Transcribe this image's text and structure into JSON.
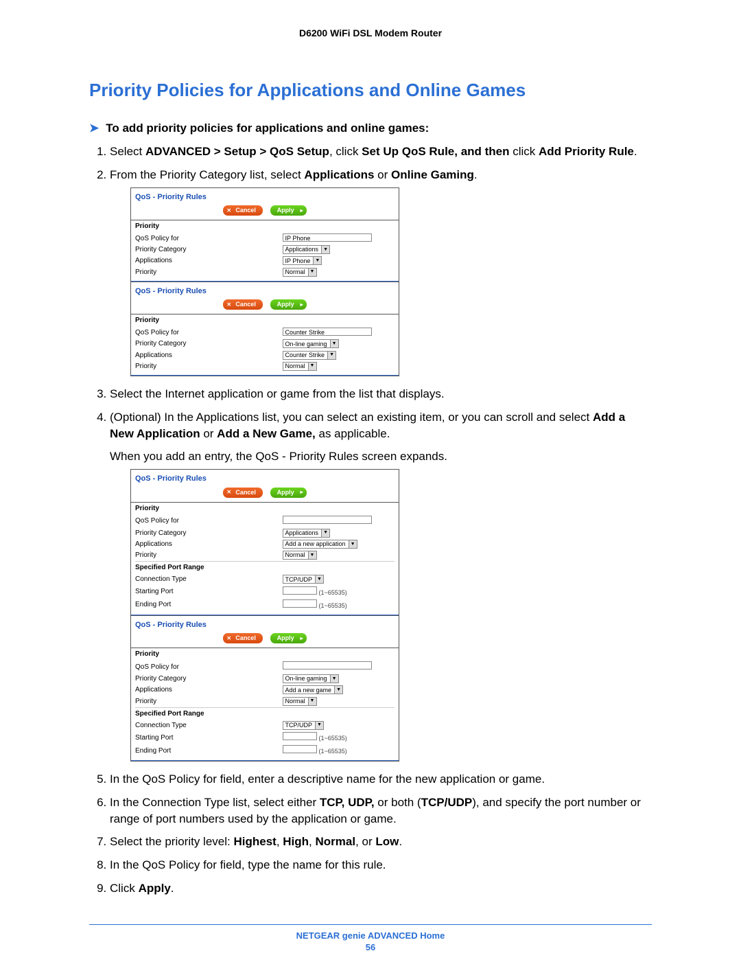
{
  "header": "D6200 WiFi DSL Modem Router",
  "title": "Priority Policies for Applications and Online Games",
  "lead": "To add priority policies for applications and online games:",
  "steps": {
    "s1a": "Select ",
    "s1b": "ADVANCED > Setup > QoS Setup",
    "s1c": ", click ",
    "s1d": "Set Up QoS Rule, and then",
    "s1e": " click ",
    "s1f": "Add Priority Rule",
    "s1g": ".",
    "s2a": "From the Priority Category list, select ",
    "s2b": "Applications",
    "s2c": " or ",
    "s2d": "Online Gaming",
    "s2e": ".",
    "s3": "Select the Internet application or game from the list that displays.",
    "s4a": "(Optional) In the Applications list, you can select an existing item, or you can scroll and select ",
    "s4b": "Add a New Application",
    "s4c": " or ",
    "s4d": "Add a New Game,",
    "s4e": " as applicable.",
    "s4f": "When you add an entry, the QoS - Priority Rules screen expands.",
    "s5": "In the QoS Policy for field, enter a descriptive name for the new application or game.",
    "s6a": "In the Connection Type list, select either ",
    "s6b": "TCP, UDP,",
    "s6c": " or both (",
    "s6d": "TCP/UDP",
    "s6e": "), and specify the port number or range of port numbers used by the application or game.",
    "s7a": "Select the priority level: ",
    "s7b": "Highest",
    "s7c": ", ",
    "s7d": "High",
    "s7e": ", ",
    "s7f": "Normal",
    "s7g": ", or ",
    "s7h": "Low",
    "s7i": ".",
    "s8": "In the QoS Policy for field, type the name for this rule.",
    "s9a": "Click ",
    "s9b": "Apply",
    "s9c": "."
  },
  "ui": {
    "panel_title": "QoS - Priority Rules",
    "cancel": "Cancel",
    "apply": "Apply",
    "priority": "Priority",
    "policy_for": "QoS Policy for",
    "category": "Priority Category",
    "applications_lbl": "Applications",
    "priority_lbl": "Priority",
    "port_range": "Specified Port Range",
    "conn_type": "Connection Type",
    "start_port": "Starting Port",
    "end_port": "Ending Port",
    "range_hint": "(1~65535)",
    "vals": {
      "ip_phone": "IP Phone",
      "applications": "Applications",
      "normal": "Normal",
      "counter_strike": "Counter Strike",
      "online_gaming": "On-line gaming",
      "add_app": "Add a new application",
      "add_game": "Add a new game",
      "tcpudp": "TCP/UDP"
    }
  },
  "footer": "NETGEAR genie ADVANCED Home",
  "page_number": "56"
}
